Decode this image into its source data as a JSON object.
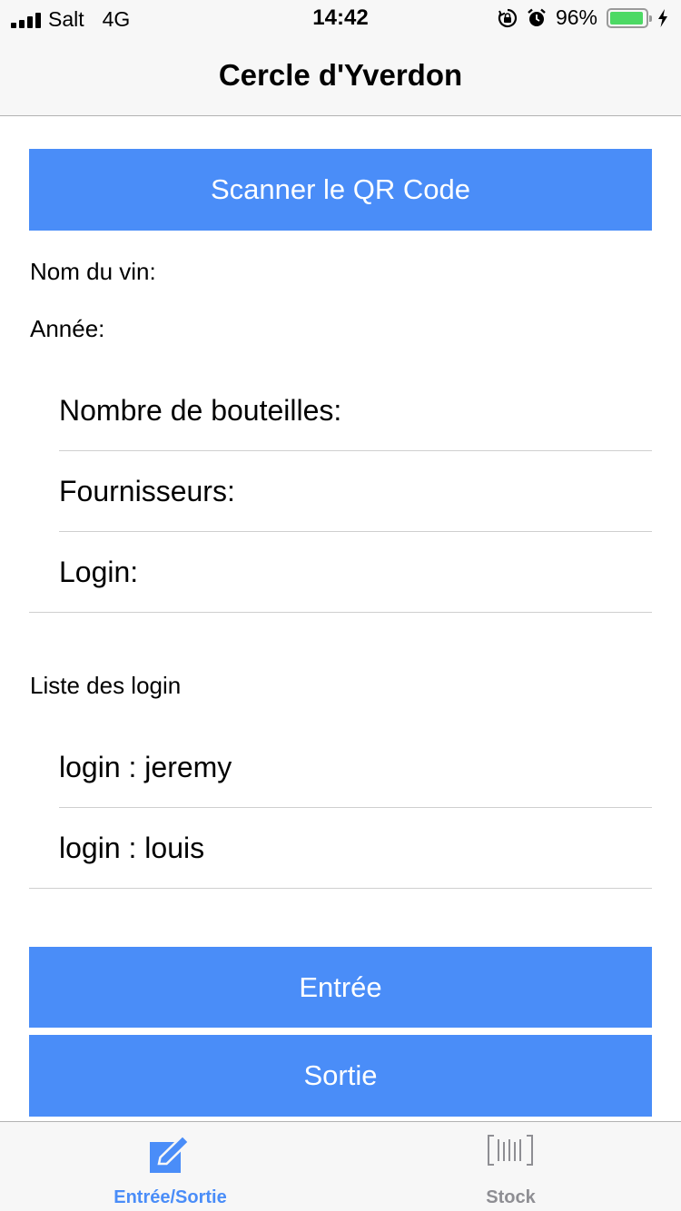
{
  "status_bar": {
    "carrier": "Salt",
    "network": "4G",
    "time": "14:42",
    "battery_percent": "96%",
    "battery_level": 0.96
  },
  "nav": {
    "title": "Cercle d'Yverdon"
  },
  "scan_button": {
    "label": "Scanner le QR Code"
  },
  "wine_info": {
    "name_label": "Nom du vin:",
    "year_label": "Année:"
  },
  "form": {
    "rows": [
      {
        "label": "Nombre de bouteilles:"
      },
      {
        "label": "Fournisseurs:"
      },
      {
        "label": "Login:"
      }
    ]
  },
  "login_list": {
    "title": "Liste des login",
    "items": [
      {
        "label": "login : jeremy"
      },
      {
        "label": "login : louis"
      }
    ]
  },
  "actions": {
    "entry_label": "Entrée",
    "exit_label": "Sortie"
  },
  "tab_bar": {
    "tabs": [
      {
        "label": "Entrée/Sortie",
        "icon": "edit-icon",
        "active": true
      },
      {
        "label": "Stock",
        "icon": "barcode-icon",
        "active": false
      }
    ]
  },
  "colors": {
    "accent": "#4a8df8",
    "tab_active": "#4a8df8",
    "tab_inactive": "#8e8e93",
    "battery": "#4cd964"
  }
}
